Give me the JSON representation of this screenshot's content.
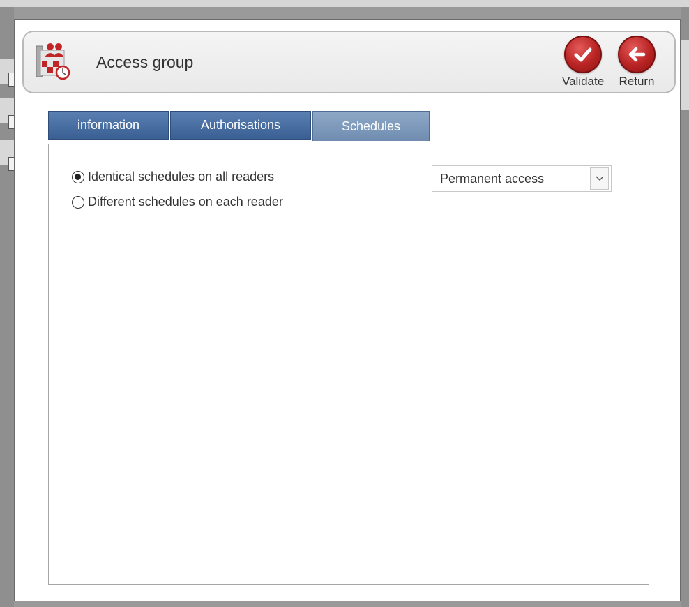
{
  "dialog": {
    "title": "Access group",
    "actions": {
      "validate_label": "Validate",
      "return_label": "Return"
    },
    "icon": "access-group-icon"
  },
  "tabs": [
    {
      "label": "information",
      "active": false
    },
    {
      "label": "Authorisations",
      "active": false
    },
    {
      "label": "Schedules",
      "active": true
    }
  ],
  "schedules": {
    "options": [
      {
        "label": "Identical schedules on all readers",
        "checked": true
      },
      {
        "label": "Different schedules on each reader",
        "checked": false
      }
    ],
    "schedule_select": {
      "value": "Permanent access"
    }
  },
  "colors": {
    "tab_inactive": "#3a5f93",
    "tab_active": "#7f99bc",
    "action_red": "#b82323"
  }
}
